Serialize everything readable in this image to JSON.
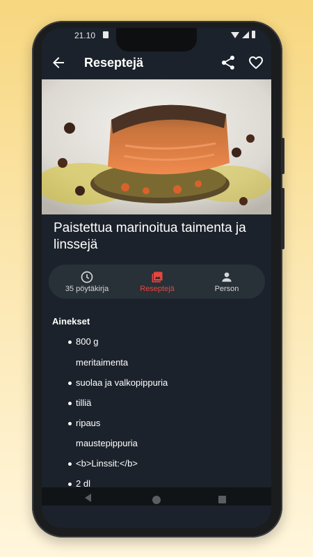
{
  "status": {
    "time": "21.10"
  },
  "appbar": {
    "title": "Reseptejä",
    "back_icon": "arrow-back-icon",
    "share_icon": "share-icon",
    "favorite_icon": "heart-outline-icon"
  },
  "recipe": {
    "title": "Paistettua marinoitua taimenta ja linssejä",
    "image_description_icon": "dish-photo"
  },
  "tabs": [
    {
      "label": "35 pöytäkirja",
      "icon": "clock-icon",
      "active": false
    },
    {
      "label": "Reseptejä",
      "icon": "photo-icon",
      "active": true
    },
    {
      "label": "Person",
      "icon": "person-icon",
      "active": false
    }
  ],
  "ingredients": {
    "heading": "Ainekset",
    "lines": [
      "800 g",
      "meritaimenta",
      "suolaa ja valkopippuria",
      "tilliä",
      "ripaus",
      "maustepippuria",
      "<b>Linssit:</b>",
      "2 dl"
    ]
  },
  "colors": {
    "background_top": "#f7d77f",
    "screen": "#1c222b",
    "tab_bar": "#283038",
    "accent": "#e5473f"
  }
}
